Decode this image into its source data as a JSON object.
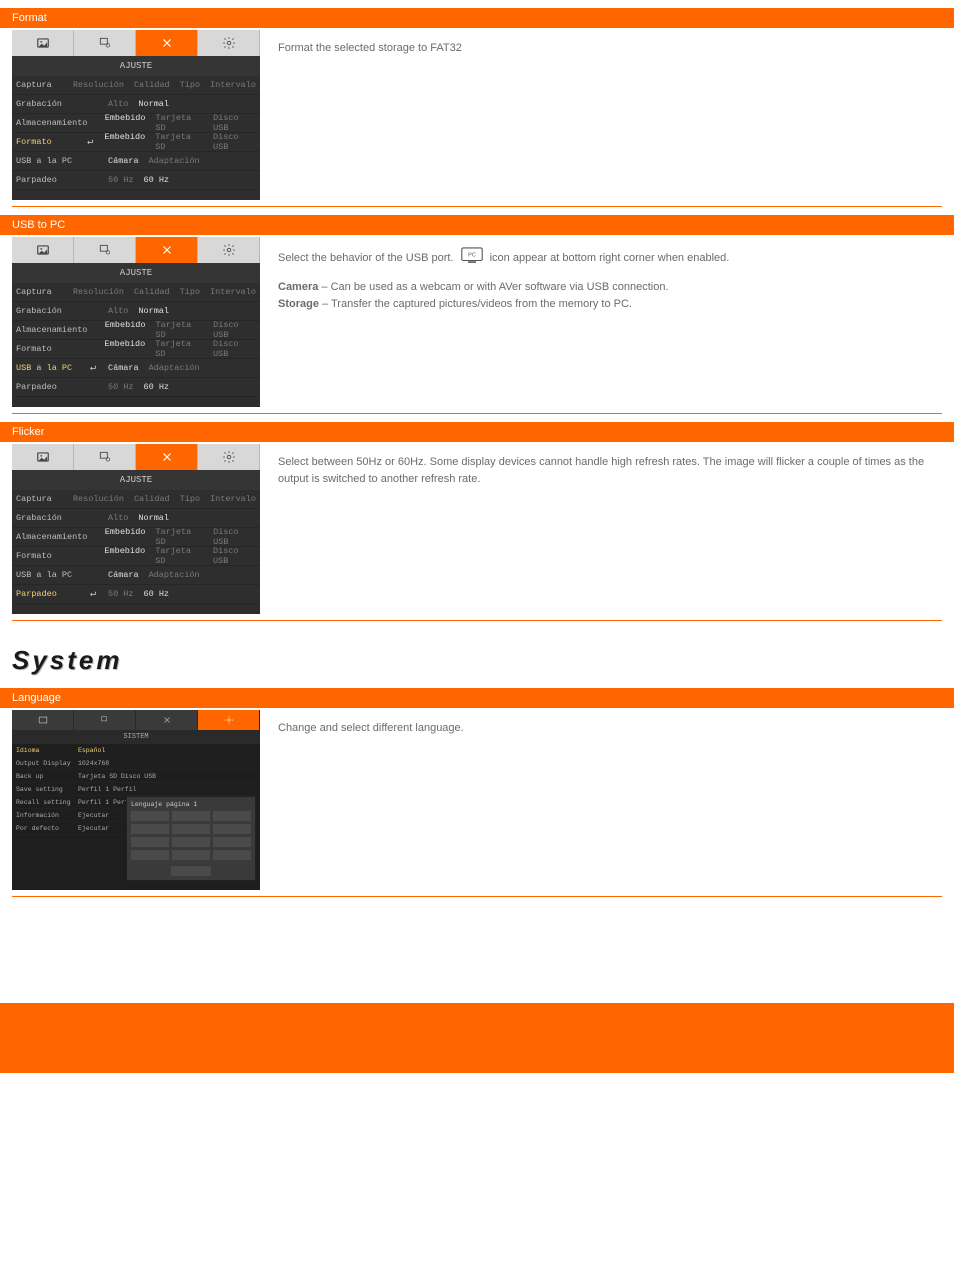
{
  "sections": {
    "format": {
      "band": "Format",
      "text": "Format the selected storage to FAT32"
    },
    "usbpc": {
      "band": "USB to PC",
      "text_a": "Select the behavior of the USB port. ",
      "text_b": " icon appear at bottom right corner when enabled."
    },
    "usbpc_options": [
      {
        "label": "Camera",
        "desc": "Can be used as a webcam or with AVer software via USB connection."
      },
      {
        "label": "Storage",
        "desc": "Transfer the captured pictures/videos from the memory to PC."
      }
    ],
    "flicker": {
      "band": "Flicker",
      "text": "Select between 50Hz or 60Hz. Some display devices cannot handle high refresh rates. The image will flicker a couple of times as the output is switched to another refresh rate."
    },
    "system_heading": "System",
    "language": {
      "band": "Language",
      "text": "Change and select different language"
    }
  },
  "menu": {
    "title": "AJUSTE",
    "tabs": [
      "image",
      "present",
      "tool",
      "gear"
    ],
    "rows": [
      {
        "label": "Captura",
        "opts": [
          "Resolución",
          "Calidad",
          "Tipo",
          "Intervalo"
        ],
        "active": 0,
        "header": true
      },
      {
        "label": "Grabación",
        "opts": [
          "Alto",
          "Normal"
        ],
        "active": 1
      },
      {
        "label": "Almacenamiento",
        "opts": [
          "Embebido",
          "Tarjeta SD",
          "Disco USB"
        ],
        "active": 0
      },
      {
        "label": "Formato",
        "opts": [
          "Embebido",
          "Tarjeta SD",
          "Disco USB"
        ],
        "active": 0
      },
      {
        "label": "USB a la PC",
        "opts": [
          "Cámara",
          "Adaptación"
        ],
        "active": 0
      },
      {
        "label": "Parpadeo",
        "opts": [
          "50 Hz",
          "60 Hz"
        ],
        "active": 0
      }
    ]
  },
  "sysmenu": {
    "title": "SISTEM",
    "rows": [
      {
        "label": "Idioma",
        "val": "Español"
      },
      {
        "label": "Output Display",
        "val": "1024x768"
      },
      {
        "label": "Back up",
        "val": "Tarjeta SD Disco USB"
      },
      {
        "label": "Save setting",
        "val": "Perfil 1   Perfil"
      },
      {
        "label": "Recall setting",
        "val": "Perfil 1   Perfil"
      },
      {
        "label": "Información",
        "val": "Ejecutar"
      },
      {
        "label": "Por defecto",
        "val": "Ejecutar"
      }
    ],
    "langpop_head": "Lenguaje página 1"
  }
}
